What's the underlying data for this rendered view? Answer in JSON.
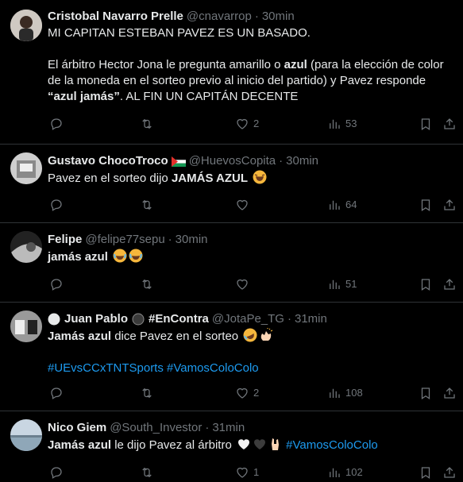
{
  "tweets": [
    {
      "name": "Cristobal Navarro Prelle",
      "handle": "@cnavarrop",
      "time": "30min",
      "p1": "MI CAPITAN ESTEBAN PAVEZ ES UN BASADO.",
      "p2a": "El árbitro Hector Jona le pregunta amarillo o ",
      "p2b": "azul",
      "p2c": " (para la elección de color de la moneda en el sorteo previo al inicio del partido) y Pavez responde ",
      "p2d": "“azul jamás”",
      "p2e": ". AL FIN UN CAPITÁN DECENTE",
      "likes": "2",
      "views": "53"
    },
    {
      "name": "Gustavo ChocoTroco",
      "handle": "@HuevosCopita",
      "time": "30min",
      "t1": "Pavez en el sorteo dijo ",
      "t2": "JAMÁS AZUL",
      "views": "64"
    },
    {
      "name": "Felipe",
      "handle": "@felipe77sepu",
      "time": "30min",
      "t1": "jamás azul",
      "views": "51"
    },
    {
      "name": "Juan Pablo",
      "name2": "#EnContra",
      "handle": "@JotaPe_TG",
      "time": "31min",
      "t1": "Jamás azul",
      "t2": " dice Pavez en el sorteo",
      "tags": "#UEvsCCxTNTSports #VamosColoColo",
      "likes": "2",
      "views": "108"
    },
    {
      "name": "Nico Giem",
      "handle": "@South_Investor",
      "time": "31min",
      "t1": "Jamás azul",
      "t2": " le dijo Pavez al árbitro",
      "tag": "#VamosColoColo",
      "likes": "1",
      "views": "102"
    }
  ],
  "separator": "·"
}
